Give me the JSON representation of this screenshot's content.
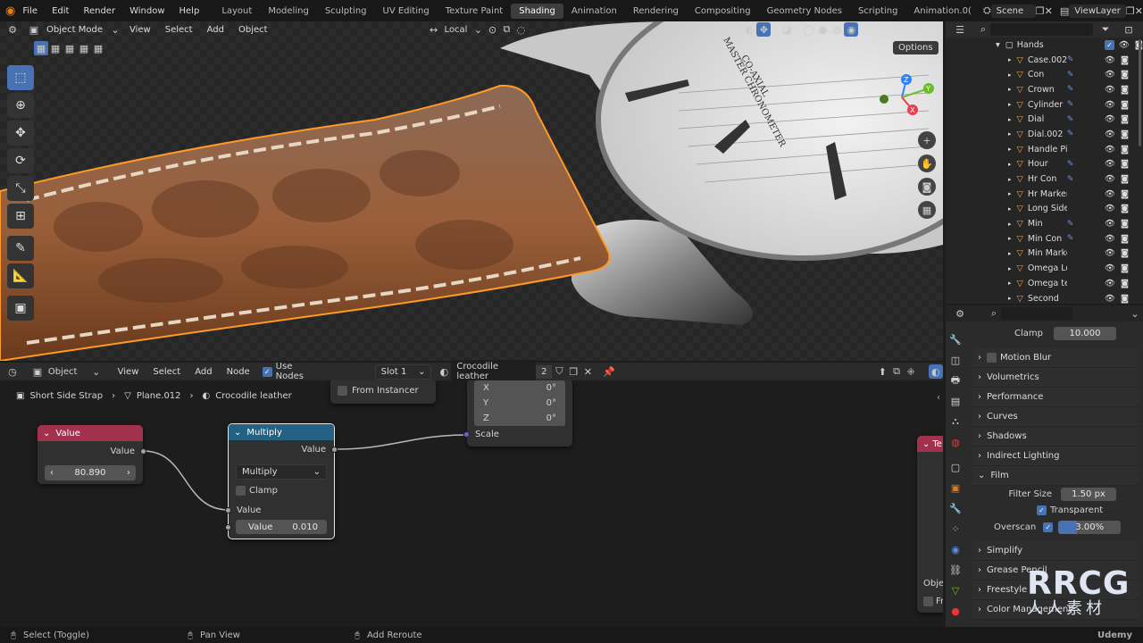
{
  "menu": [
    "File",
    "Edit",
    "Render",
    "Window",
    "Help"
  ],
  "workspaces": [
    "Layout",
    "Modeling",
    "Sculpting",
    "UV Editing",
    "Texture Paint",
    "Shading",
    "Animation",
    "Rendering",
    "Compositing",
    "Geometry Nodes",
    "Scripting",
    "Animation.0("
  ],
  "active_workspace": "Shading",
  "scene": {
    "label": "Scene",
    "view_layer": "ViewLayer"
  },
  "viewport": {
    "mode": "Object Mode",
    "menus": [
      "View",
      "Select",
      "Add",
      "Object"
    ],
    "orientation": "Local",
    "options": "Options",
    "dial_text": [
      "CO-AXIAL",
      "MASTER CHRONOMETER"
    ],
    "gizmo": {
      "z": "Z",
      "y": "Y",
      "x": "X"
    }
  },
  "outliner": {
    "collection": "Hands",
    "items": [
      "Case.002",
      "Con",
      "Crown",
      "Cylinder",
      "Dial",
      "Dial.002",
      "Handle Pin",
      "Hour",
      "Hr Con",
      "Hr Markers",
      "Long Side Con",
      "Min",
      "Min Con",
      "Min Markers",
      "Omega Logo",
      "Omega text L",
      "Second"
    ]
  },
  "properties": {
    "clamp": {
      "label": "Clamp",
      "value": "10.000"
    },
    "panels": [
      "Motion Blur",
      "Volumetrics",
      "Performance",
      "Curves",
      "Shadows",
      "Indirect Lighting",
      "Film"
    ],
    "film": {
      "filter_size_label": "Filter Size",
      "filter_size": "1.50 px",
      "transparent": "Transparent",
      "overscan_label": "Overscan",
      "overscan": "3.00%"
    },
    "more": [
      "Simplify",
      "Grease Pencil",
      "Freestyle",
      "Color Management"
    ]
  },
  "node_editor": {
    "mode": "Object",
    "menus": [
      "View",
      "Select",
      "Add",
      "Node"
    ],
    "use_nodes": "Use Nodes",
    "slot": "Slot 1",
    "material": "Crocodile leather",
    "users": "2",
    "breadcrumb": [
      "Short Side Strap",
      "Plane.012",
      "Crocodile leather"
    ],
    "value_node": {
      "title": "Value",
      "output": "Value",
      "value": "80.890"
    },
    "multiply_node": {
      "title": "Multiply",
      "output": "Value",
      "operation": "Multiply",
      "clamp": "Clamp",
      "input": "Value",
      "field_label": "Value",
      "field_value": "0.010"
    },
    "mapping_node": {
      "from_instancer": "From Instancer",
      "x": "X",
      "y": "Y",
      "z": "Z",
      "xv": "0°",
      "yv": "0°",
      "zv": "0°",
      "scale": "Scale"
    },
    "partial_node": {
      "title": "Te",
      "label1": "Objec",
      "label2": "Fr"
    }
  },
  "status": {
    "select": "Select (Toggle)",
    "pan": "Pan View",
    "reroute": "Add Reroute"
  },
  "watermark": {
    "brand": "RRCG",
    "sub": "人人素材",
    "udemy": "Udemy"
  }
}
